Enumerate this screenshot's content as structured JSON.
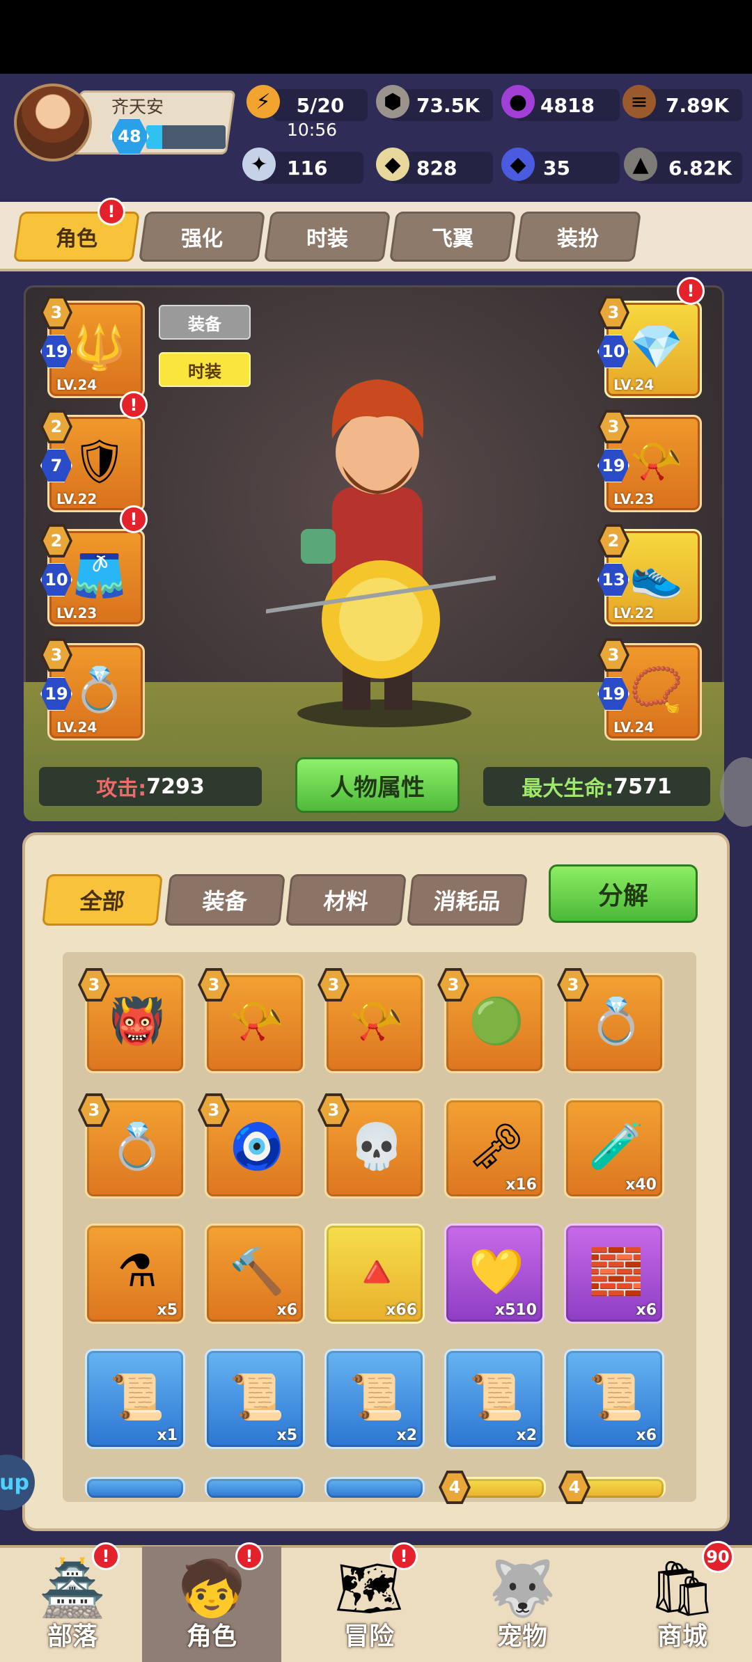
{
  "player": {
    "name": "齐天安",
    "level": "48",
    "exp_fraction": 0.2
  },
  "resources": [
    {
      "icon": "energy-icon",
      "value": "5/20",
      "sub": "10:56"
    },
    {
      "icon": "stone-ore-icon",
      "value": "73.5K"
    },
    {
      "icon": "purple-gem-icon",
      "value": "4818"
    },
    {
      "icon": "wood-icon",
      "value": "7.89K"
    },
    {
      "icon": "bone-icon",
      "value": "116"
    },
    {
      "icon": "shield-coin-icon",
      "value": "828"
    },
    {
      "icon": "blue-crystal-icon",
      "value": "35"
    },
    {
      "icon": "rock-icon",
      "value": "6.82K"
    }
  ],
  "tabs": [
    {
      "label": "角色",
      "active": true,
      "alert": true
    },
    {
      "label": "强化"
    },
    {
      "label": "时装"
    },
    {
      "label": "飞翼"
    },
    {
      "label": "装扮"
    }
  ],
  "view_toggle": {
    "equip": "装备",
    "fashion": "时装"
  },
  "equip_left": [
    {
      "tier": "3",
      "stars": "19",
      "lv": "LV.24",
      "icon": "spear-icon"
    },
    {
      "tier": "2",
      "stars": "7",
      "lv": "LV.22",
      "icon": "armor-icon",
      "alert": true
    },
    {
      "tier": "2",
      "stars": "10",
      "lv": "LV.23",
      "icon": "pants-icon",
      "alert": true
    },
    {
      "tier": "3",
      "stars": "19",
      "lv": "LV.24",
      "icon": "ring-icon"
    }
  ],
  "equip_right": [
    {
      "tier": "3",
      "stars": "10",
      "lv": "LV.24",
      "icon": "crystal-helm-icon",
      "alert": true,
      "gold": true
    },
    {
      "tier": "3",
      "stars": "19",
      "lv": "LV.23",
      "icon": "horn-boot-icon"
    },
    {
      "tier": "2",
      "stars": "13",
      "lv": "LV.22",
      "icon": "shoes-icon",
      "gold": true
    },
    {
      "tier": "3",
      "stars": "19",
      "lv": "LV.24",
      "icon": "necklace-icon"
    }
  ],
  "stats": {
    "attack_label": "攻击:",
    "attack_value": "7293",
    "attr_button": "人物属性",
    "hp_label": "最大生命:",
    "hp_value": "7571"
  },
  "inventory": {
    "tabs": [
      "全部",
      "装备",
      "材料",
      "消耗品"
    ],
    "decompose": "分解",
    "items": [
      {
        "icon": "mask-icon",
        "tier": "3",
        "color": "orange"
      },
      {
        "icon": "horn-icon",
        "tier": "3",
        "color": "orange"
      },
      {
        "icon": "horn-icon",
        "tier": "3",
        "color": "orange"
      },
      {
        "icon": "green-ring-icon",
        "tier": "3",
        "color": "orange"
      },
      {
        "icon": "ring-icon",
        "tier": "3",
        "color": "orange"
      },
      {
        "icon": "ring-icon",
        "tier": "3",
        "color": "orange"
      },
      {
        "icon": "pendant-icon",
        "tier": "3",
        "color": "orange"
      },
      {
        "icon": "skull-pendant-icon",
        "tier": "3",
        "color": "orange"
      },
      {
        "icon": "key-icon",
        "count": "x16",
        "color": "orange"
      },
      {
        "icon": "potion-bottle-icon",
        "count": "x40",
        "color": "orange"
      },
      {
        "icon": "green-potion-icon",
        "count": "x5",
        "color": "orange"
      },
      {
        "icon": "hammer-icon",
        "count": "x6",
        "color": "orange"
      },
      {
        "icon": "gold-pile-icon",
        "count": "x66",
        "color": "gold"
      },
      {
        "icon": "gold-heart-icon",
        "count": "x510",
        "color": "purple"
      },
      {
        "icon": "purple-block-icon",
        "count": "x6",
        "color": "purple"
      },
      {
        "icon": "scroll-icon",
        "count": "x1",
        "color": "blue"
      },
      {
        "icon": "scroll-icon",
        "count": "x5",
        "color": "blue"
      },
      {
        "icon": "scroll-icon",
        "count": "x2",
        "color": "blue"
      },
      {
        "icon": "scroll-icon",
        "count": "x2",
        "color": "blue"
      },
      {
        "icon": "scroll-icon",
        "count": "x6",
        "color": "blue"
      }
    ],
    "partial_row_tiers": [
      "4",
      "4"
    ]
  },
  "nav": [
    {
      "label": "部落",
      "icon": "tribe-icon",
      "alert": true
    },
    {
      "label": "角色",
      "icon": "hero-icon",
      "alert": true,
      "active": true
    },
    {
      "label": "冒险",
      "icon": "map-icon",
      "alert": true
    },
    {
      "label": "宠物",
      "icon": "pet-icon"
    },
    {
      "label": "商城",
      "icon": "shop-icon",
      "badge": "90"
    }
  ],
  "edge_label": "up"
}
